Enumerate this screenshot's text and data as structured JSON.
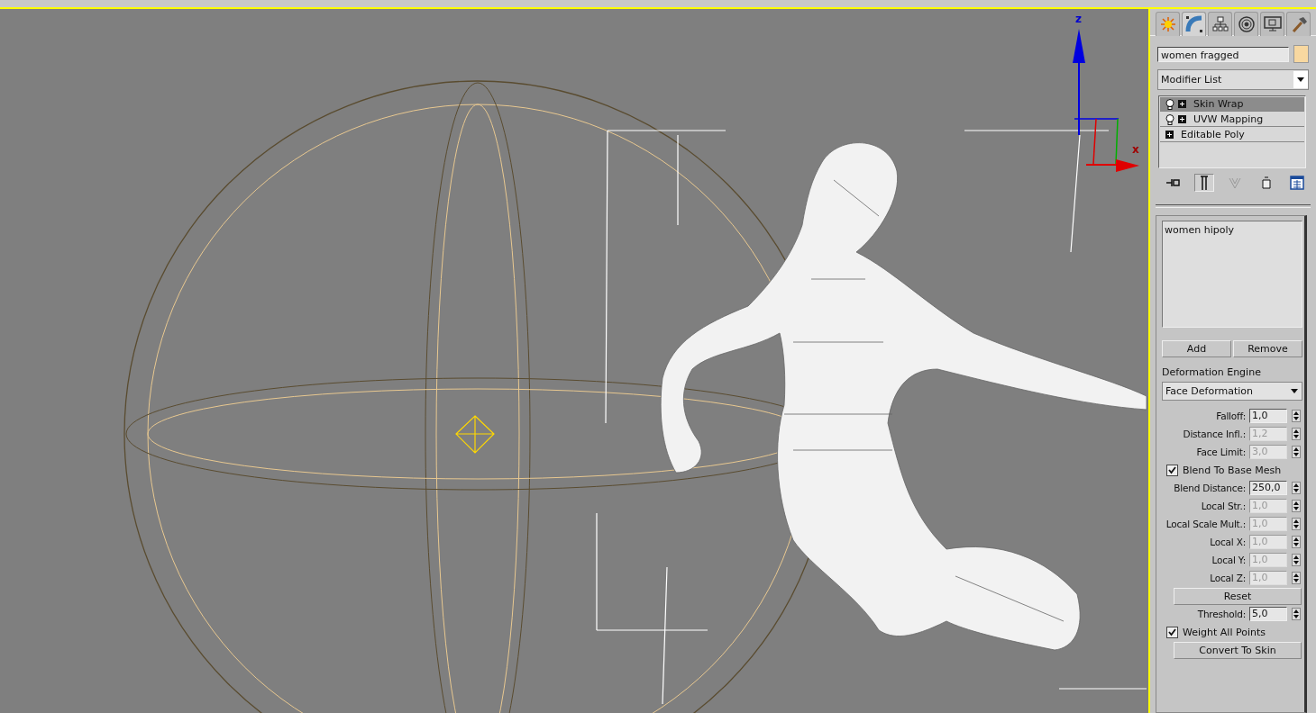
{
  "viewport": {
    "axis_labels": [
      "z",
      "x"
    ]
  },
  "command_panel": {
    "tabs": [
      {
        "kind": "create",
        "selected": false
      },
      {
        "kind": "modify",
        "selected": true
      },
      {
        "kind": "hierarchy",
        "selected": false
      },
      {
        "kind": "motion",
        "selected": false
      },
      {
        "kind": "display",
        "selected": false
      },
      {
        "kind": "utilities",
        "selected": false
      }
    ],
    "object_name": "women fragged",
    "modifier_list": "Modifier List",
    "stack": [
      {
        "label": "Skin Wrap",
        "bulb": true,
        "selected": true
      },
      {
        "label": "UVW Mapping",
        "bulb": true,
        "selected": false
      },
      {
        "label": "Editable Poly",
        "bulb": false,
        "selected": false
      }
    ],
    "stack_tools": [
      {
        "kind": "pin",
        "selected": false
      },
      {
        "kind": "end-result",
        "selected": true
      },
      {
        "kind": "unique",
        "selected": false
      },
      {
        "kind": "remove",
        "selected": false
      },
      {
        "kind": "configure",
        "selected": false
      }
    ],
    "targets": [
      "women hipoly"
    ],
    "add_button": "Add",
    "remove_button": "Remove",
    "engine_label": "Deformation Engine",
    "engine_value": "Face Deformation",
    "controls": [
      {
        "kind": "spinner",
        "label": "Falloff:",
        "value": "1,0",
        "disabled": false
      },
      {
        "kind": "spinner",
        "label": "Distance Infl.:",
        "value": "1,2",
        "disabled": true
      },
      {
        "kind": "spinner",
        "label": "Face Limit:",
        "value": "3,0",
        "disabled": true
      },
      {
        "kind": "checkbox",
        "label": "Blend To Base Mesh",
        "checked": true
      },
      {
        "kind": "spinner",
        "label": "Blend Distance:",
        "value": "250,0",
        "disabled": false
      },
      {
        "kind": "spinner",
        "label": "Local Str.:",
        "value": "1,0",
        "disabled": true
      },
      {
        "kind": "spinner",
        "label": "Local Scale Mult.:",
        "value": "1,0",
        "disabled": true
      },
      {
        "kind": "spinner",
        "label": "Local X:",
        "value": "1,0",
        "disabled": true
      },
      {
        "kind": "spinner",
        "label": "Local Y:",
        "value": "1,0",
        "disabled": true
      },
      {
        "kind": "spinner",
        "label": "Local Z:",
        "value": "1,0",
        "disabled": true
      },
      {
        "kind": "button",
        "label": "Reset"
      },
      {
        "kind": "spinner",
        "label": "Threshold:",
        "value": "5,0",
        "disabled": false
      },
      {
        "kind": "checkbox",
        "label": "Weight All Points",
        "checked": true
      },
      {
        "kind": "button",
        "label": "Convert To Skin"
      }
    ]
  }
}
